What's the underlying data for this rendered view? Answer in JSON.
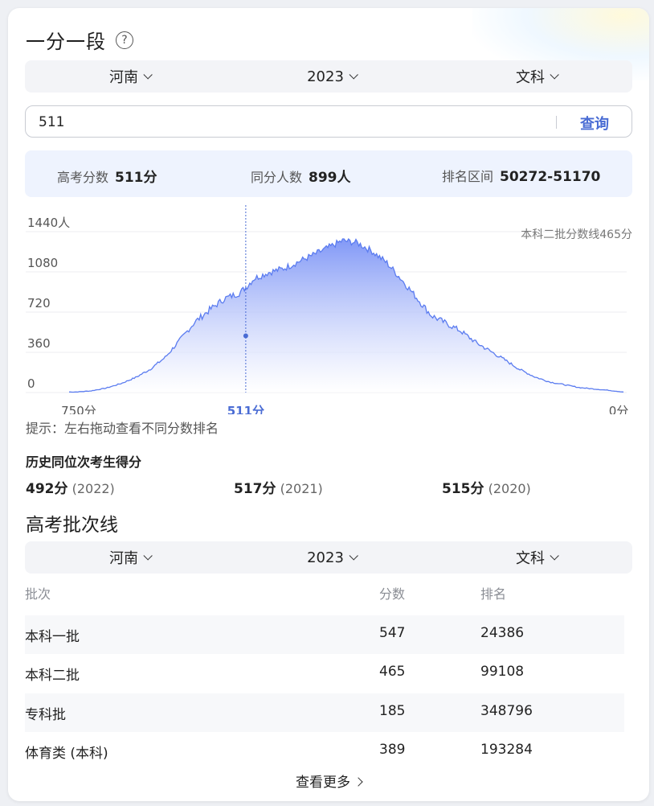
{
  "header": {
    "title": "一分一段",
    "help_icon": "question-circle-icon"
  },
  "selectors": {
    "province": "河南",
    "year": "2023",
    "subject": "文科"
  },
  "search": {
    "value": "511",
    "button_label": "查询"
  },
  "stats": {
    "score_label": "高考分数",
    "score_value": "511分",
    "same_label": "同分人数",
    "same_value": "899人",
    "rank_label": "排名区间",
    "rank_value": "50272-51170"
  },
  "chart_data": {
    "type": "area",
    "y_ticks": [
      "1440人",
      "1080",
      "720",
      "360",
      "0"
    ],
    "y_tick_values": [
      1440,
      1080,
      720,
      360,
      0
    ],
    "x_left_label": "750分",
    "x_right_label": "0分",
    "marker_label": "511分",
    "marker_score": 511,
    "annotation": "本科二批分数线465分",
    "xlim": [
      750,
      0
    ],
    "ylim": [
      0,
      1440
    ],
    "series": [
      {
        "scores": [
          750,
          740,
          720,
          700,
          680,
          660,
          640,
          620,
          600,
          580,
          560,
          540,
          520,
          511,
          500,
          480,
          460,
          440,
          420,
          400,
          380,
          360,
          340,
          320,
          300,
          280,
          260,
          240,
          220,
          200,
          180,
          160,
          140,
          120,
          100,
          80,
          60,
          40,
          20,
          0
        ],
        "values": [
          5,
          5,
          15,
          40,
          80,
          135,
          210,
          315,
          470,
          630,
          740,
          840,
          890,
          940,
          1020,
          1075,
          1110,
          1170,
          1230,
          1295,
          1360,
          1340,
          1265,
          1160,
          1010,
          850,
          690,
          620,
          550,
          450,
          370,
          290,
          205,
          140,
          95,
          70,
          45,
          32,
          20,
          5
        ]
      }
    ],
    "colors": {
      "line": "#5b7cf0",
      "fill_top": "#7b93f6",
      "fill_bottom": "#ffffff",
      "marker": "#4a6cd4"
    }
  },
  "hint": "提示：左右拖动查看不同分数排名",
  "history": {
    "title": "历史同位次考生得分",
    "items": [
      {
        "score": "492分",
        "year": "(2022)"
      },
      {
        "score": "517分",
        "year": "(2021)"
      },
      {
        "score": "515分",
        "year": "(2020)"
      }
    ]
  },
  "batch": {
    "title": "高考批次线",
    "selectors": {
      "province": "河南",
      "year": "2023",
      "subject": "文科"
    },
    "headers": [
      "批次",
      "分数",
      "排名"
    ],
    "rows": [
      {
        "name": "本科一批",
        "score": "547",
        "rank": "24386"
      },
      {
        "name": "本科二批",
        "score": "465",
        "rank": "99108"
      },
      {
        "name": "专科批",
        "score": "185",
        "rank": "348796"
      },
      {
        "name": "体育类 (本科)",
        "score": "389",
        "rank": "193284"
      }
    ],
    "more_label": "查看更多"
  }
}
